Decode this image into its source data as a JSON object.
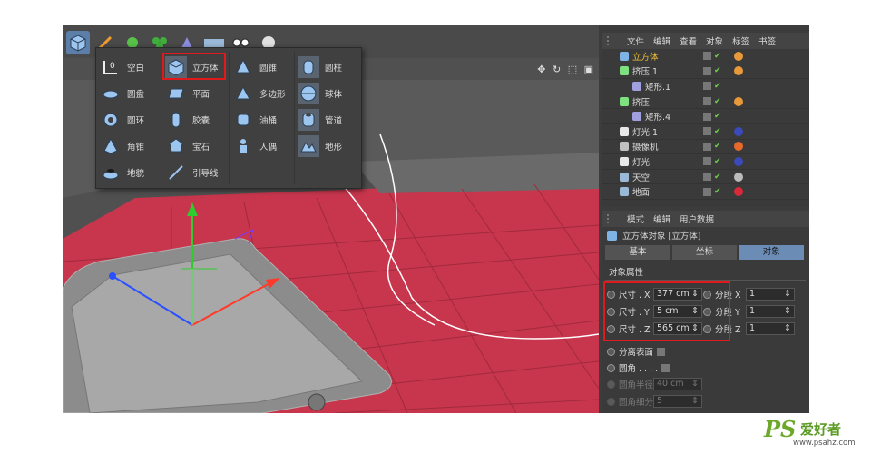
{
  "toolbar": {
    "icons": [
      "cube-icon",
      "pen-icon",
      "generator-icon",
      "array-icon",
      "deformer-icon",
      "floor-icon",
      "camera-icon",
      "light-icon"
    ]
  },
  "viewport": {
    "nav_icons": "✥ ↻ ⬚ ▣"
  },
  "menu": {
    "items": [
      {
        "label": "空白",
        "icon": "null-icon"
      },
      {
        "label": "立方体",
        "icon": "cube-icon"
      },
      {
        "label": "圆锥",
        "icon": "cone-icon"
      },
      {
        "label": "圆柱",
        "icon": "cylinder-icon"
      },
      {
        "label": "圆盘",
        "icon": "disc-icon"
      },
      {
        "label": "平面",
        "icon": "plane-icon"
      },
      {
        "label": "多边形",
        "icon": "polygon-icon"
      },
      {
        "label": "球体",
        "icon": "sphere-icon"
      },
      {
        "label": "圆环",
        "icon": "torus-icon"
      },
      {
        "label": "胶囊",
        "icon": "capsule-icon"
      },
      {
        "label": "油桶",
        "icon": "oil-tank-icon"
      },
      {
        "label": "管道",
        "icon": "tube-icon"
      },
      {
        "label": "角锥",
        "icon": "pyramid-icon"
      },
      {
        "label": "宝石",
        "icon": "platonic-icon"
      },
      {
        "label": "人偶",
        "icon": "figure-icon"
      },
      {
        "label": "地形",
        "icon": "landscape-icon"
      },
      {
        "label": "地貌",
        "icon": "relief-icon"
      },
      {
        "label": "引导线",
        "icon": "guide-icon"
      }
    ]
  },
  "objects": {
    "menu": [
      "文件",
      "编辑",
      "查看",
      "对象",
      "标签",
      "书签"
    ],
    "rows": [
      {
        "name": "立方体",
        "color": "#7fb2e5",
        "selected": true,
        "tag": "phong"
      },
      {
        "name": "挤压.1",
        "color": "#7fe07f",
        "selected": false,
        "tag": "phong"
      },
      {
        "name": "矩形.1",
        "color": "#a0a0e0",
        "selected": false,
        "tag": ""
      },
      {
        "name": "挤压",
        "color": "#7fe07f",
        "selected": false,
        "tag": "phong"
      },
      {
        "name": "矩形.4",
        "color": "#a0a0e0",
        "selected": false,
        "tag": ""
      },
      {
        "name": "灯光.1",
        "color": "#e8e8e8",
        "selected": false,
        "tag": "target"
      },
      {
        "name": "摄像机",
        "color": "#c0c0c0",
        "selected": false,
        "tag": "protect"
      },
      {
        "name": "灯光",
        "color": "#e8e8e8",
        "selected": false,
        "tag": "target"
      },
      {
        "name": "天空",
        "color": "#9ab8d8",
        "selected": false,
        "tag": "material"
      },
      {
        "name": "地面",
        "color": "#9ab8d8",
        "selected": false,
        "tag": "ball"
      }
    ]
  },
  "attributes": {
    "menu": [
      "模式",
      "编辑",
      "用户数据"
    ],
    "title": "立方体对象 [立方体]",
    "tabs": [
      "基本",
      "坐标",
      "对象"
    ],
    "active_tab": "对象",
    "section": "对象属性",
    "size_x_label": "尺寸 . X",
    "size_x": "377 cm",
    "size_y_label": "尺寸 . Y",
    "size_y": "5 cm",
    "size_z_label": "尺寸 . Z",
    "size_z": "565 cm",
    "seg_x_label": "分段 X",
    "seg_x": "1",
    "seg_y_label": "分段 Y",
    "seg_y": "1",
    "seg_z_label": "分段 Z",
    "seg_z": "1",
    "separate_label": "分离表面",
    "fillet_label": "圆角 . . . .",
    "fillet_radius_label": "圆角半径",
    "fillet_radius": "40 cm",
    "fillet_sub_label": "圆角细分",
    "fillet_sub": "5"
  },
  "watermark": {
    "brand": "PS",
    "cn": "爱好者",
    "url": "www.psahz.com"
  },
  "colors": {
    "accent": "#e0191d",
    "floor": "#c23a4f",
    "active_tab": "#6b8cb5"
  }
}
